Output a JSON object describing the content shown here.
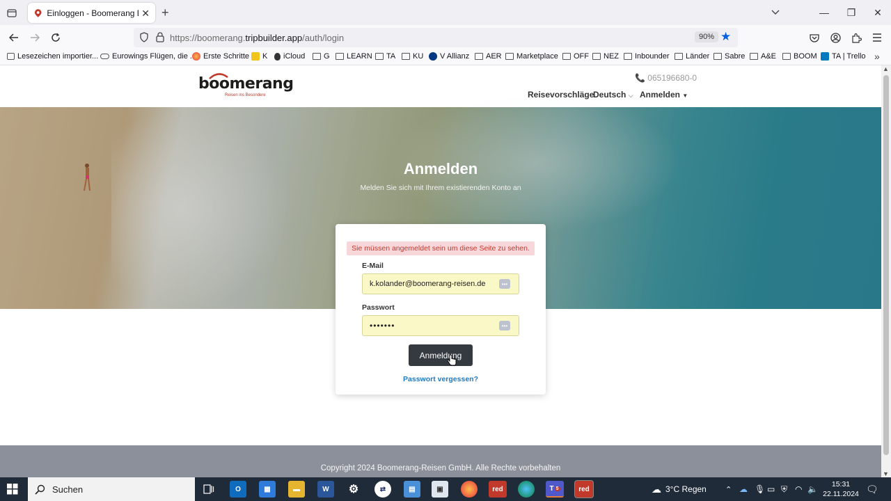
{
  "browser": {
    "tab_title": "Einloggen - Boomerang DE - B",
    "url_host_prefix": "https://boomerang.",
    "url_host_main": "tripbuilder.app",
    "url_path": "/auth/login",
    "zoom": "90%"
  },
  "bookmarks": [
    {
      "label": "Lesezeichen importier..."
    },
    {
      "label": "Eurowings Flügen, die ..."
    },
    {
      "label": "Erste Schritte"
    },
    {
      "label": "K"
    },
    {
      "label": "iCloud"
    },
    {
      "label": "G"
    },
    {
      "label": "LEARN"
    },
    {
      "label": "TA"
    },
    {
      "label": "KU"
    },
    {
      "label": "V Allianz"
    },
    {
      "label": "AER"
    },
    {
      "label": "Marketplace"
    },
    {
      "label": "OFF"
    },
    {
      "label": "NEZ"
    },
    {
      "label": "Inbounder"
    },
    {
      "label": "Länder"
    },
    {
      "label": "Sabre"
    },
    {
      "label": "A&E"
    },
    {
      "label": "BOOM"
    },
    {
      "label": "TA | Trello"
    }
  ],
  "site": {
    "logo_word_prefix": "bo",
    "logo_word_suffix": "merang",
    "logo_tagline": "Reisen ins Besondere",
    "phone": "065196680-0",
    "menu": {
      "trips": "Reisevorschläge",
      "language": "Deutsch",
      "login": "Anmelden"
    }
  },
  "hero": {
    "title": "Anmelden",
    "subtitle": "Melden Sie sich mit Ihrem existierenden Konto an"
  },
  "login_form": {
    "alert": "Sie müssen angemeldet sein um diese Seite zu sehen.",
    "email_label": "E-Mail",
    "email_value": "k.kolander@boomerang-reisen.de",
    "password_label": "Passwort",
    "password_value": "•••••••",
    "submit_label": "Anmeldung",
    "forgot_label": "Passwort vergessen?"
  },
  "footer": {
    "copyright": "Copyright 2024 Boomerang-Reisen GmbH. Alle Rechte vorbehalten"
  },
  "taskbar": {
    "search_label": "Suchen",
    "weather": "3°C  Regen",
    "teams_badge": "5",
    "red_label": "red",
    "time": "15:31",
    "date": "22.11.2024"
  }
}
